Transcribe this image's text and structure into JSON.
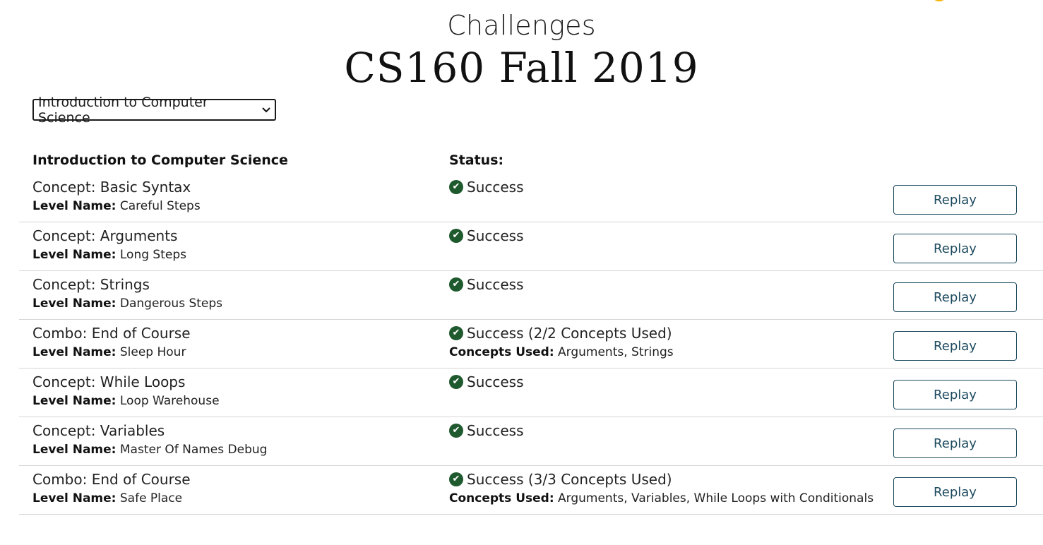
{
  "header": {
    "subtitle": "Challenges",
    "title": "CS160 Fall 2019"
  },
  "course_select": {
    "selected": "Introduction to Computer Science"
  },
  "table": {
    "col_course": "Introduction to Computer Science",
    "col_status": "Status:",
    "level_label": "Level Name:",
    "concepts_used_label": "Concepts Used:",
    "replay_label": "Replay",
    "rows": [
      {
        "concept": "Concept: Basic Syntax",
        "level": "Careful Steps",
        "status": "Success",
        "used": ""
      },
      {
        "concept": "Concept: Arguments",
        "level": "Long Steps",
        "status": "Success",
        "used": ""
      },
      {
        "concept": "Concept: Strings",
        "level": "Dangerous Steps",
        "status": "Success",
        "used": ""
      },
      {
        "concept": "Combo: End of Course",
        "level": "Sleep Hour",
        "status": "Success (2/2 Concepts Used)",
        "used": "Arguments, Strings"
      },
      {
        "concept": "Concept: While Loops",
        "level": "Loop Warehouse",
        "status": "Success",
        "used": ""
      },
      {
        "concept": "Concept: Variables",
        "level": "Master Of Names Debug",
        "status": "Success",
        "used": ""
      },
      {
        "concept": "Combo: End of Course",
        "level": "Safe Place",
        "status": "Success (3/3 Concepts Used)",
        "used": "Arguments, Variables, While Loops with Conditionals"
      }
    ]
  },
  "colors": {
    "success": "#1f5a2e",
    "button": "#1d4a5f",
    "accent": "#f5b400"
  },
  "icons": {
    "status": "check-circle-icon",
    "select": "chevron-down-icon"
  }
}
